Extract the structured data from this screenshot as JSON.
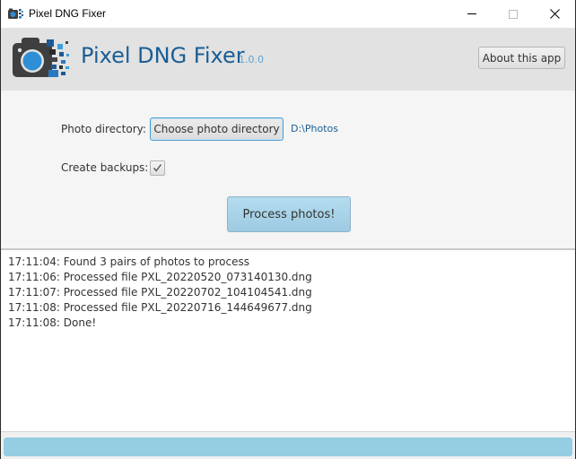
{
  "window": {
    "title": "Pixel DNG Fixer",
    "controls": {
      "minimize": "minimize-icon",
      "maximize": "maximize-icon",
      "close": "close-icon"
    }
  },
  "header": {
    "app_name": "Pixel DNG Fixer",
    "version": "1.0.0",
    "about_label": "About this app",
    "logo": "camera-pixels-logo"
  },
  "controls": {
    "photo_directory_label": "Photo directory:",
    "choose_button_label": "Choose photo directory",
    "directory_path": "D:\\Photos",
    "create_backups_label": "Create backups:",
    "create_backups_checked": true,
    "process_button_label": "Process photos!"
  },
  "log": {
    "lines": [
      "17:11:04: Found 3 pairs of photos to process",
      "17:11:06: Processed file PXL_20220520_073140130.dng",
      "17:11:07: Processed file PXL_20220702_104104541.dng",
      "17:11:08: Processed file PXL_20220716_144649677.dng",
      "17:11:08: Done!"
    ]
  },
  "progress": {
    "value_percent": 100
  },
  "colors": {
    "brand_blue": "#1a5e96",
    "version_blue": "#5ea3d6",
    "progress_fill": "#95cee2",
    "process_button": "#a8d3ea"
  }
}
